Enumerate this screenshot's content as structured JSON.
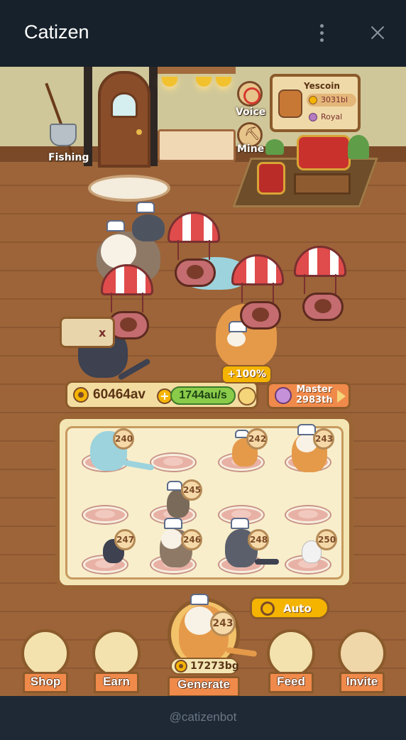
{
  "window": {
    "title": "Catizen",
    "menu_icon": "vertical-dots-icon",
    "close_icon": "close-icon"
  },
  "room": {
    "fishing_label": "Fishing",
    "voice_label": "Voice",
    "mine_label": "Mine",
    "yescoin": {
      "name": "Yescoin",
      "amount": "3031bl",
      "tier": "Royal"
    }
  },
  "boost_tag": "x",
  "economy": {
    "balance": "60464av",
    "rate": "1744au/s",
    "speed_boost": "+100%"
  },
  "master": {
    "title": "Master",
    "rank": "2983th"
  },
  "board": {
    "cat_levels": [
      "240",
      "242",
      "243",
      "245",
      "247",
      "246",
      "248",
      "250"
    ]
  },
  "auto_label": "Auto",
  "generate": {
    "cat_level": "243",
    "cost": "17273bg",
    "label": "Generate"
  },
  "nav": {
    "shop": "Shop",
    "earn": "Earn",
    "feed": "Feed",
    "invite": "Invite"
  },
  "footer": {
    "bot_handle": "@catizenbot"
  },
  "colors": {
    "accent_orange": "#f08a4b",
    "coin_gold": "#f4b400",
    "rate_green": "#8acb4a",
    "wood_dark": "#8b5a2b",
    "header_bg": "#17212b"
  }
}
